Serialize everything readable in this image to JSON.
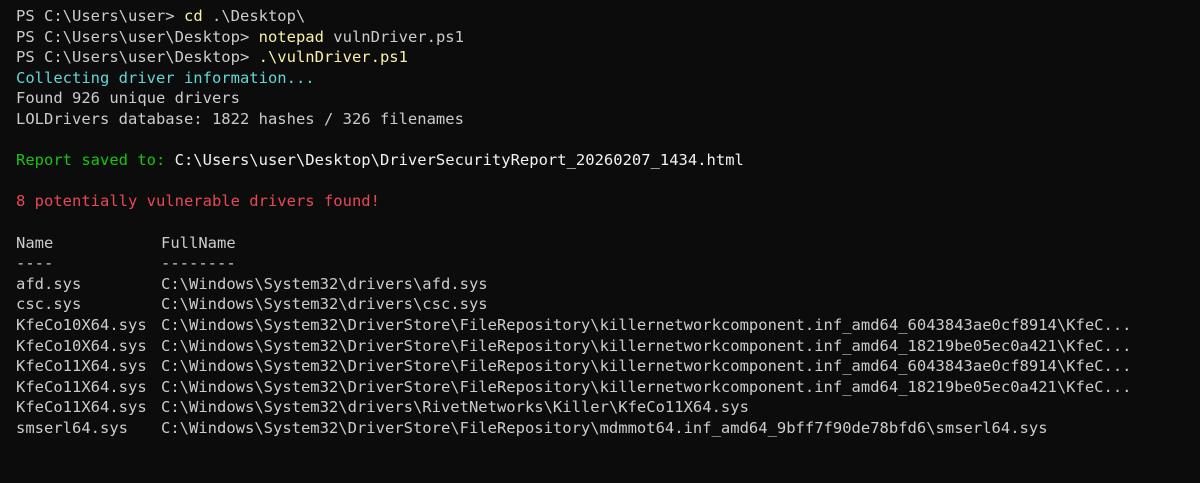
{
  "terminal": {
    "lines": [
      {
        "prompt": "PS C:\\Users\\user> ",
        "cmd": "cd",
        "args": " .\\Desktop\\"
      },
      {
        "prompt": "PS C:\\Users\\user\\Desktop> ",
        "cmd": "notepad",
        "args": " vulnDriver.ps1"
      },
      {
        "prompt": "PS C:\\Users\\user\\Desktop> ",
        "cmd": ".\\vulnDriver.ps1",
        "args": ""
      }
    ],
    "collecting": "Collecting driver information...",
    "found": "Found 926 unique drivers",
    "lol_db": "LOLDrivers database: 1822 hashes / 326 filenames",
    "report_label": "Report saved to: ",
    "report_path": "C:\\Users\\user\\Desktop\\DriverSecurityReport_20260207_1434.html",
    "vuln_message": "8 potentially vulnerable drivers found!",
    "table": {
      "headers": [
        "Name",
        "FullName"
      ],
      "underlines": [
        "----",
        "--------"
      ],
      "rows": [
        {
          "name": "afd.sys",
          "fullname": "C:\\Windows\\System32\\drivers\\afd.sys"
        },
        {
          "name": "csc.sys",
          "fullname": "C:\\Windows\\System32\\drivers\\csc.sys"
        },
        {
          "name": "KfeCo10X64.sys",
          "fullname": "C:\\Windows\\System32\\DriverStore\\FileRepository\\killernetworkcomponent.inf_amd64_6043843ae0cf8914\\KfeC..."
        },
        {
          "name": "KfeCo10X64.sys",
          "fullname": "C:\\Windows\\System32\\DriverStore\\FileRepository\\killernetworkcomponent.inf_amd64_18219be05ec0a421\\KfeC..."
        },
        {
          "name": "KfeCo11X64.sys",
          "fullname": "C:\\Windows\\System32\\DriverStore\\FileRepository\\killernetworkcomponent.inf_amd64_6043843ae0cf8914\\KfeC..."
        },
        {
          "name": "KfeCo11X64.sys",
          "fullname": "C:\\Windows\\System32\\DriverStore\\FileRepository\\killernetworkcomponent.inf_amd64_18219be05ec0a421\\KfeC..."
        },
        {
          "name": "KfeCo11X64.sys",
          "fullname": "C:\\Windows\\System32\\drivers\\RivetNetworks\\Killer\\KfeCo11X64.sys"
        },
        {
          "name": "smserl64.sys",
          "fullname": "C:\\Windows\\System32\\DriverStore\\FileRepository\\mdmmot64.inf_amd64_9bff7f90de78bfd6\\smserl64.sys"
        }
      ]
    },
    "colors": {
      "background": "#0c0c0c",
      "foreground": "#cccccc",
      "command": "#f9f1a5",
      "cyan": "#61d6d6",
      "green": "#16c60c",
      "red": "#e74856"
    }
  }
}
